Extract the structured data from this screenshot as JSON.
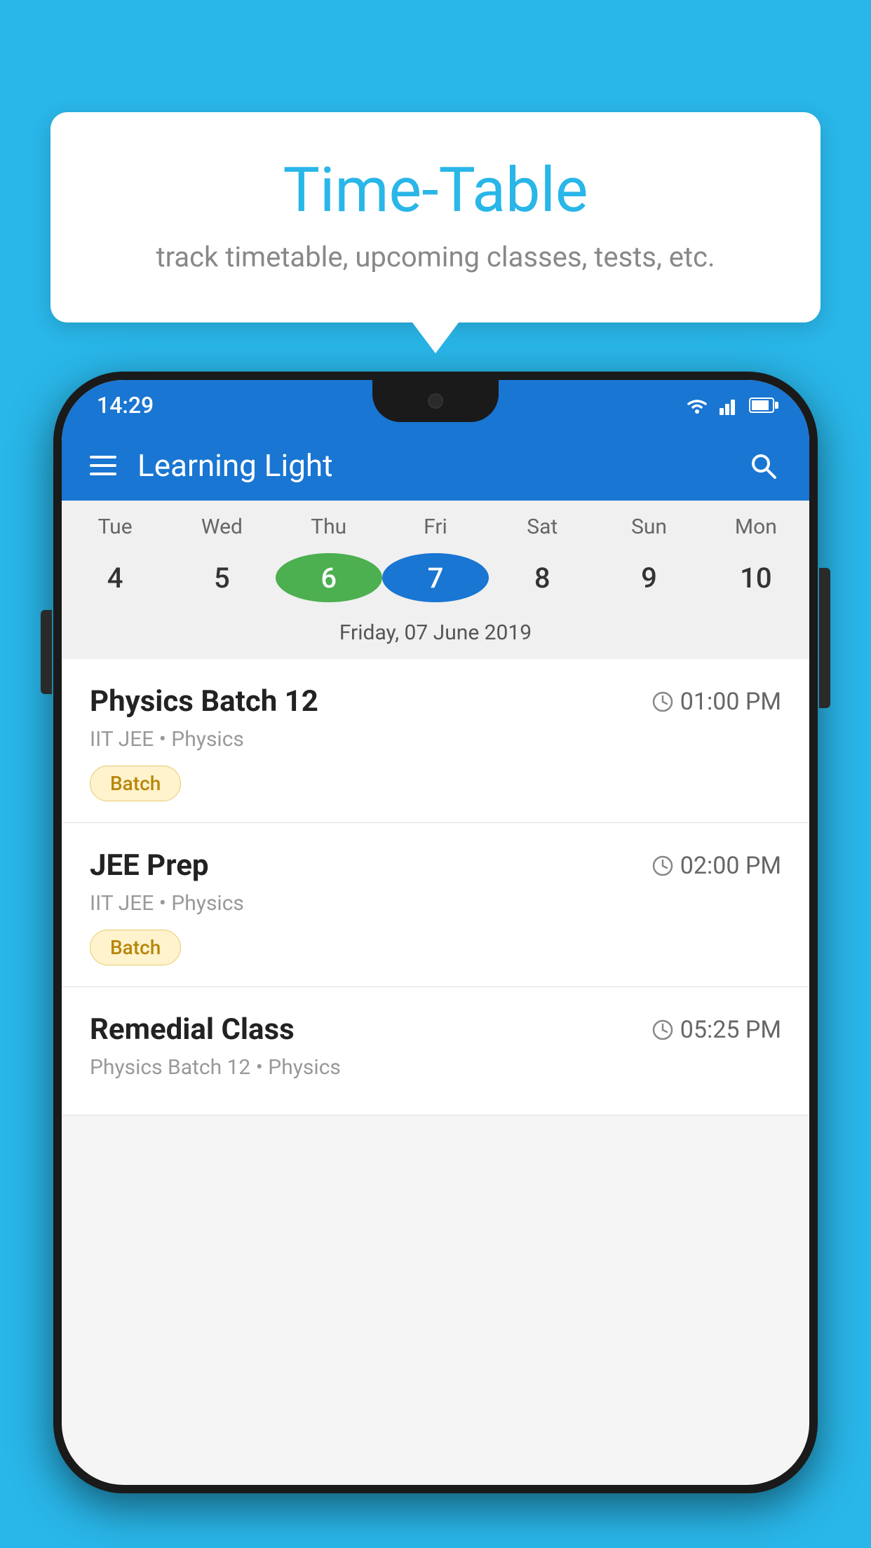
{
  "background_color": "#29b6e8",
  "tooltip": {
    "title": "Time-Table",
    "subtitle": "track timetable, upcoming classes, tests, etc."
  },
  "status_bar": {
    "time": "14:29",
    "icons": [
      "wifi",
      "signal",
      "battery"
    ]
  },
  "app_bar": {
    "title": "Learning Light",
    "search_icon": "🔍"
  },
  "calendar": {
    "days": [
      {
        "name": "Tue",
        "number": "4"
      },
      {
        "name": "Wed",
        "number": "5"
      },
      {
        "name": "Thu",
        "number": "6",
        "state": "today"
      },
      {
        "name": "Fri",
        "number": "7",
        "state": "selected"
      },
      {
        "name": "Sat",
        "number": "8"
      },
      {
        "name": "Sun",
        "number": "9"
      },
      {
        "name": "Mon",
        "number": "10"
      }
    ],
    "selected_date": "Friday, 07 June 2019"
  },
  "schedule": [
    {
      "name": "Physics Batch 12",
      "time": "01:00 PM",
      "meta": "IIT JEE • Physics",
      "badge": "Batch"
    },
    {
      "name": "JEE Prep",
      "time": "02:00 PM",
      "meta": "IIT JEE • Physics",
      "badge": "Batch"
    },
    {
      "name": "Remedial Class",
      "time": "05:25 PM",
      "meta": "Physics Batch 12 • Physics",
      "badge": ""
    }
  ]
}
